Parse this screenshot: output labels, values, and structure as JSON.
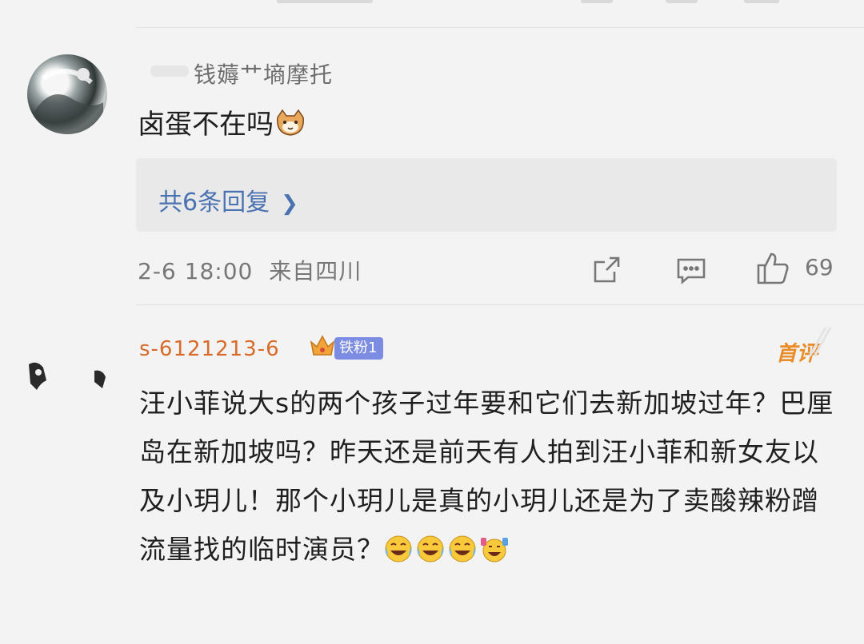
{
  "comment1": {
    "username": "钱薅艹墒摩托",
    "text": "卤蛋不在吗",
    "emoji": "cat-face-emoji",
    "replies_link": "共6条回复",
    "time": "2-6 18:00",
    "location": "来自四川",
    "likes": "69"
  },
  "comment2": {
    "username": "s-6121213-6",
    "fan_badge": "铁粉1",
    "top_label": "首评",
    "text": "汪小菲说大s的两个孩子过年要和它们去新加坡过年？巴厘岛在新加坡吗？昨天还是前天有人拍到汪小菲和新女友以及小玥儿！那个小玥儿是真的小玥儿还是为了卖酸辣粉蹭流量找的临时演员？",
    "emojis": [
      "crying-laughing-emoji",
      "crying-laughing-emoji",
      "crying-laughing-emoji",
      "cheering-emoji"
    ]
  },
  "colors": {
    "background": "#f3f3f3",
    "link_blue": "#4b72b0",
    "username_orange": "#d86a2a",
    "badge_purple": "#7c8ce2",
    "top_orange": "#e98c28"
  }
}
